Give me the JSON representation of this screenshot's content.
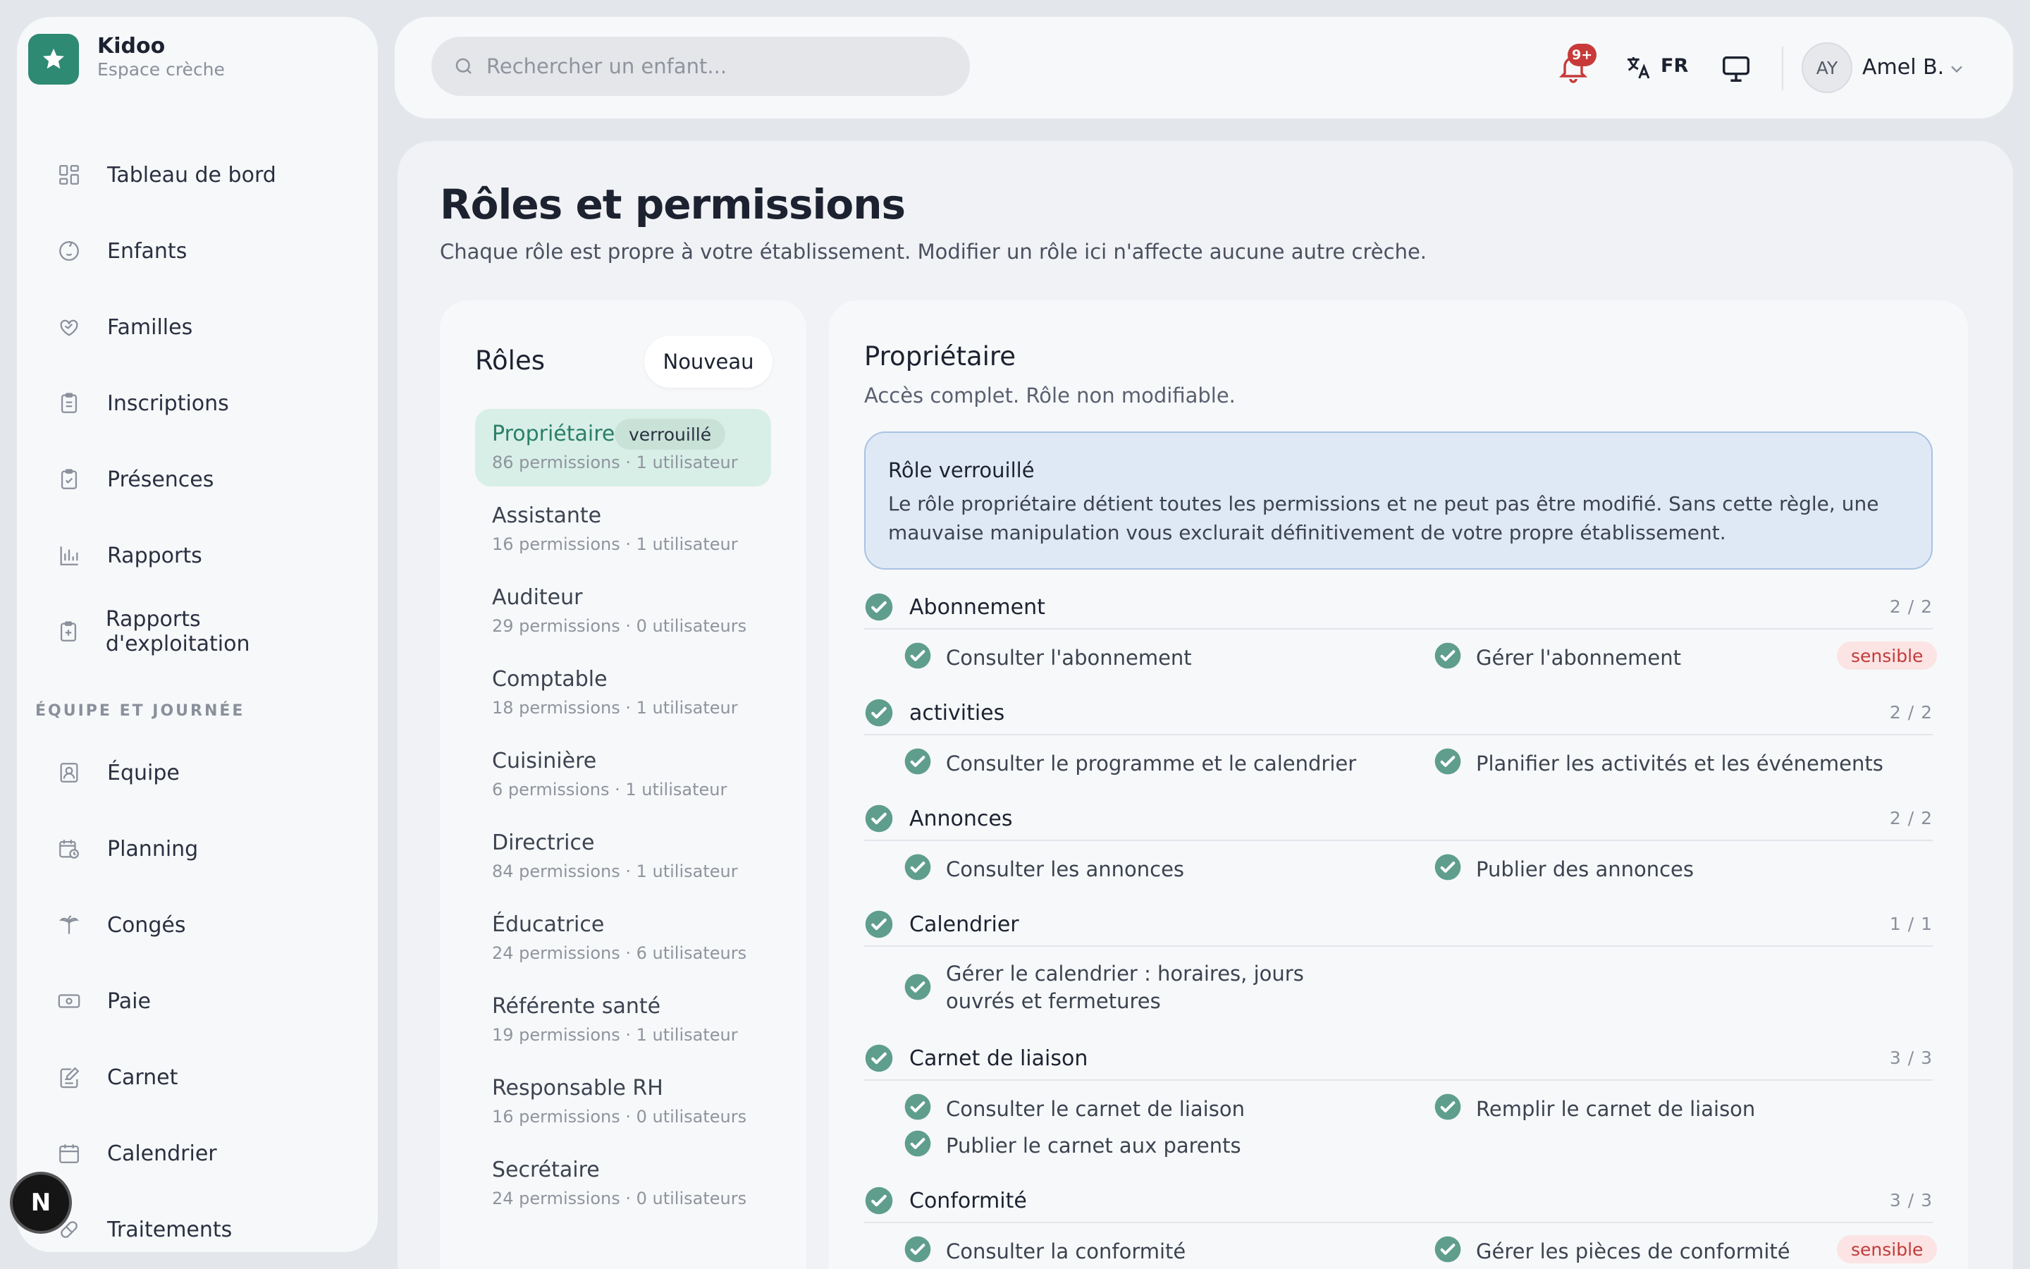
{
  "brand": {
    "name": "Kidoo",
    "subtitle": "Espace crèche"
  },
  "sidebar": {
    "items": [
      {
        "label": "Tableau de bord",
        "icon": "dashboard-icon"
      },
      {
        "label": "Enfants",
        "icon": "child-face-icon"
      },
      {
        "label": "Familles",
        "icon": "heart-hand-icon"
      },
      {
        "label": "Inscriptions",
        "icon": "clipboard-icon"
      },
      {
        "label": "Présences",
        "icon": "clipboard-check-icon"
      },
      {
        "label": "Rapports",
        "icon": "bar-chart-icon"
      },
      {
        "label": "Rapports d'exploitation",
        "icon": "clipboard-plus-icon"
      }
    ],
    "section_label": "ÉQUIPE ET JOURNÉE",
    "team_items": [
      {
        "label": "Équipe",
        "icon": "id-badge-icon"
      },
      {
        "label": "Planning",
        "icon": "calendar-clock-icon"
      },
      {
        "label": "Congés",
        "icon": "palm-tree-icon"
      },
      {
        "label": "Paie",
        "icon": "banknote-icon"
      },
      {
        "label": "Carnet",
        "icon": "notebook-pen-icon"
      },
      {
        "label": "Calendrier",
        "icon": "calendar-icon"
      },
      {
        "label": "Traitements",
        "icon": "pill-icon"
      }
    ],
    "dev_badge": "N"
  },
  "topbar": {
    "search_placeholder": "Rechercher un enfant...",
    "notifications_badge": "9+",
    "language": "FR",
    "user_initials": "AY",
    "user_name": "Amel B."
  },
  "page": {
    "title": "Rôles et permissions",
    "subtitle": "Chaque rôle est propre à votre établissement. Modifier un rôle ici n'affecte aucune autre crèche."
  },
  "roles_panel": {
    "title": "Rôles",
    "new_button": "Nouveau",
    "roles": [
      {
        "name": "Propriétaire",
        "meta": "86 permissions · 1 utilisateur",
        "badge": "verrouillé"
      },
      {
        "name": "Assistante",
        "meta": "16 permissions · 1 utilisateur"
      },
      {
        "name": "Auditeur",
        "meta": "29 permissions · 0 utilisateurs"
      },
      {
        "name": "Comptable",
        "meta": "18 permissions · 1 utilisateur"
      },
      {
        "name": "Cuisinière",
        "meta": "6 permissions · 1 utilisateur"
      },
      {
        "name": "Directrice",
        "meta": "84 permissions · 1 utilisateur"
      },
      {
        "name": "Éducatrice",
        "meta": "24 permissions · 6 utilisateurs"
      },
      {
        "name": "Référente santé",
        "meta": "19 permissions · 1 utilisateur"
      },
      {
        "name": "Responsable RH",
        "meta": "16 permissions · 0 utilisateurs"
      },
      {
        "name": "Secrétaire",
        "meta": "24 permissions · 0 utilisateurs"
      }
    ]
  },
  "detail": {
    "title": "Propriétaire",
    "subtitle": "Accès complet. Rôle non modifiable.",
    "alert_title": "Rôle verrouillé",
    "alert_body": "Le rôle propriétaire détient toutes les permissions et ne peut pas être modifié. Sans cette règle, une mauvaise manipulation vous exclurait définitivement de votre propre établissement.",
    "sensitive_label": "sensible",
    "categories": [
      {
        "name": "Abonnement",
        "count": "2 / 2",
        "perms": [
          {
            "label": "Consulter l'abonnement"
          },
          {
            "label": "Gérer l'abonnement",
            "sensitive": true
          }
        ]
      },
      {
        "name": "activities",
        "count": "2 / 2",
        "perms": [
          {
            "label": "Consulter le programme et le calendrier"
          },
          {
            "label": "Planifier les activités et les événements"
          }
        ]
      },
      {
        "name": "Annonces",
        "count": "2 / 2",
        "perms": [
          {
            "label": "Consulter les annonces"
          },
          {
            "label": "Publier des annonces"
          }
        ]
      },
      {
        "name": "Calendrier",
        "count": "1 / 1",
        "perms": [
          {
            "label": "Gérer le calendrier : horaires, jours ouvrés et fermetures"
          }
        ]
      },
      {
        "name": "Carnet de liaison",
        "count": "3 / 3",
        "perms": [
          {
            "label": "Consulter le carnet de liaison"
          },
          {
            "label": "Remplir le carnet de liaison"
          },
          {
            "label": "Publier le carnet aux parents"
          }
        ]
      },
      {
        "name": "Conformité",
        "count": "3 / 3",
        "perms": [
          {
            "label": "Consulter la conformité"
          },
          {
            "label": "Gérer les pièces de conformité",
            "sensitive": true
          }
        ]
      }
    ]
  }
}
